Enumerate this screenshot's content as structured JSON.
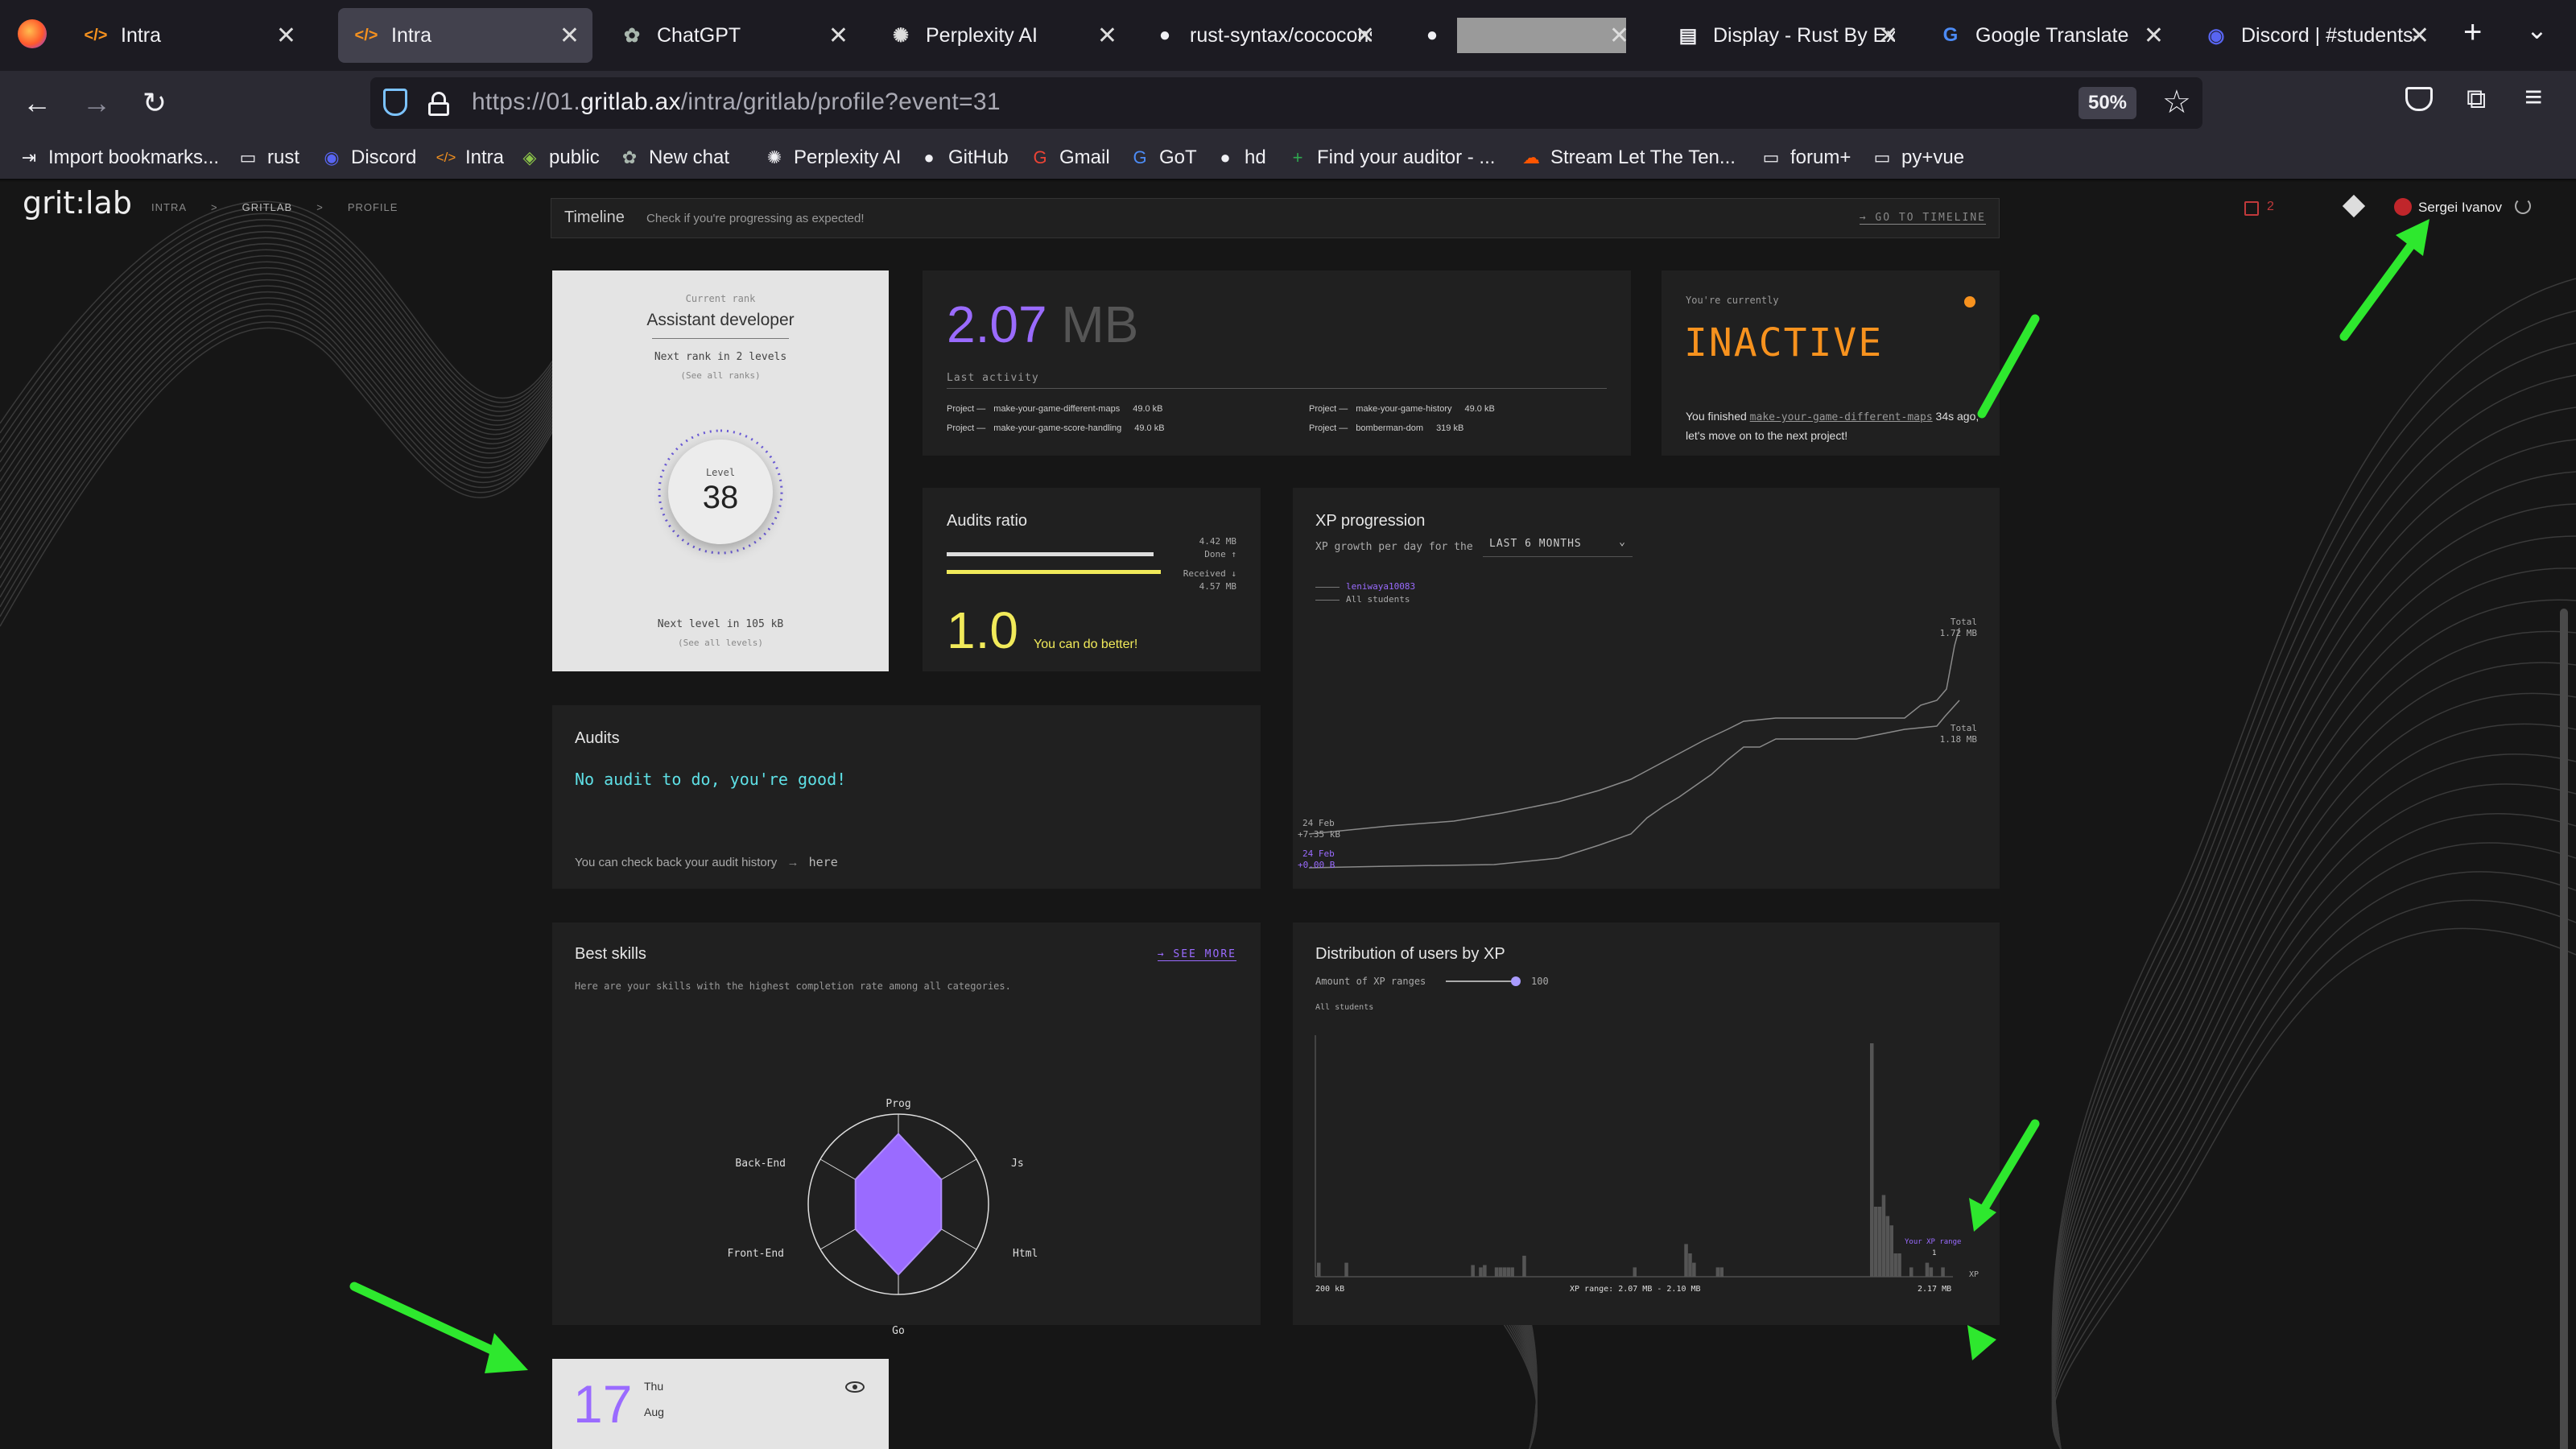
{
  "tabs": [
    {
      "label": "Intra",
      "icon": "code-icon",
      "active": false
    },
    {
      "label": "Intra",
      "icon": "code-icon",
      "active": true
    },
    {
      "label": "ChatGPT",
      "icon": "openai-icon",
      "active": false
    },
    {
      "label": "Perplexity AI",
      "icon": "perplexity-icon",
      "active": false
    },
    {
      "label": "rust-syntax/cococonscious",
      "icon": "github-icon",
      "active": false
    },
    {
      "label": "",
      "icon": "github-icon",
      "active": false
    },
    {
      "label": "Display - Rust By Example",
      "icon": "book-icon",
      "active": false
    },
    {
      "label": "Google Translate",
      "icon": "translate-icon",
      "active": false
    },
    {
      "label": "Discord | #students-",
      "icon": "discord-icon",
      "active": false
    }
  ],
  "url": {
    "prefix": "https://01.",
    "domain": "gritlab.ax",
    "path": "/intra/gritlab/profile?event=31"
  },
  "zoom": "50%",
  "bookmarks": [
    {
      "label": "Import bookmarks...",
      "icon": "import-icon"
    },
    {
      "label": "rust",
      "icon": "folder-icon"
    },
    {
      "label": "Discord",
      "icon": "discord-icon"
    },
    {
      "label": "Intra",
      "icon": "code-icon"
    },
    {
      "label": "public",
      "icon": "public-icon"
    },
    {
      "label": "New chat",
      "icon": "openai-icon"
    },
    {
      "label": "Perplexity AI",
      "icon": "perplexity-icon"
    },
    {
      "label": "GitHub",
      "icon": "github-icon"
    },
    {
      "label": "Gmail",
      "icon": "google-icon"
    },
    {
      "label": "GoT",
      "icon": "translate-icon"
    },
    {
      "label": "hd",
      "icon": "github-icon"
    },
    {
      "label": "Find your auditor - ...",
      "icon": "green-plus-icon"
    },
    {
      "label": "Stream Let The Ten...",
      "icon": "soundcloud-icon"
    },
    {
      "label": "forum+",
      "icon": "folder-icon"
    },
    {
      "label": "py+vue",
      "icon": "folder-icon"
    }
  ],
  "header": {
    "logo": "grit:lab",
    "crumbs": [
      "INTRA",
      ">",
      "GRITLAB",
      ">",
      "PROFILE"
    ],
    "notif_count": "2",
    "user": "Sergei Ivanov"
  },
  "timeline": {
    "title": "Timeline",
    "desc": "Check if you're progressing as expected!",
    "link": "→ GO TO TIMELINE"
  },
  "rank": {
    "caption": "Current rank",
    "name": "Assistant developer",
    "next": "Next rank in 2 levels",
    "see_ranks": "(See all ranks)",
    "level_label": "Level",
    "level": "38",
    "next_level": "Next level in 105 kB",
    "see_levels": "(See all levels)",
    "progress": 0.42
  },
  "xp": {
    "value": "2.07",
    "unit": "MB",
    "caption": "Last activity",
    "items": [
      {
        "kind": "Project —",
        "name": "make-your-game-different-maps",
        "size": "49.0 kB"
      },
      {
        "kind": "Project —",
        "name": "make-your-game-score-handling",
        "size": "49.0 kB"
      },
      {
        "kind": "Project —",
        "name": "make-your-game-history",
        "size": "49.0 kB"
      },
      {
        "kind": "Project —",
        "name": "bomberman-dom",
        "size": "319 kB"
      }
    ]
  },
  "status": {
    "caption": "You're currently",
    "state": "INACTIVE",
    "msg_a": "You finished",
    "project": "make-your-game-different-maps",
    "msg_b": "34s ago, let's move on to the next project!"
  },
  "audit_ratio": {
    "title": "Audits ratio",
    "done_val": "4.42 MB",
    "done_label": "Done ↑",
    "recv_label": "Received ↓",
    "recv_val": "4.57 MB",
    "ratio": "1.0",
    "comment": "You can do better!",
    "done_frac": 0.967,
    "recv_frac": 1.0
  },
  "audits": {
    "title": "Audits",
    "message": "No audit to do, you're good!",
    "history": "You can check back your audit history",
    "history_link": "here"
  },
  "xp_progression": {
    "title": "XP progression",
    "label": "XP growth per day for the",
    "period": "LAST 6 MONTHS",
    "legend": [
      "leniwaya10083",
      "All students"
    ],
    "total_user_label": "Total",
    "total_user": "1.72 MB",
    "total_all_label": "Total",
    "total_all": "1.18 MB",
    "start_user_date": "24 Feb",
    "start_user_val": "+7.35 kB",
    "start_all_date": "24 Feb",
    "start_all_val": "+0.00 B"
  },
  "skills": {
    "title": "Best skills",
    "see_more": "→ SEE MORE",
    "desc": "Here are your skills with the highest completion rate among all categories.",
    "axes": [
      "Prog",
      "Js",
      "Html",
      "Go",
      "Front-End",
      "Back-End"
    ]
  },
  "distribution": {
    "title": "Distribution of users by XP",
    "control_label": "Amount of XP ranges",
    "control_value": "100",
    "sublabel": "All students",
    "your_range_label": "Your XP range",
    "your_range_count": "1",
    "x_min": "200 kB",
    "x_mid": "XP range: 2.07 MB - 2.10 MB",
    "x_max": "2.17 MB",
    "x_unit": "XP"
  },
  "calendar": {
    "day": "17",
    "weekday": "Thu",
    "month": "Aug"
  },
  "chart_data": [
    {
      "type": "line",
      "title": "XP progression",
      "series": [
        {
          "name": "leniwaya10083",
          "start": "+7.35 kB",
          "total": "1.72 MB"
        },
        {
          "name": "All students",
          "start": "+0.00 B",
          "total": "1.18 MB"
        }
      ],
      "x_start": "24 Feb"
    },
    {
      "type": "bar",
      "title": "Distribution of users by XP",
      "x_range": [
        "200 kB",
        "2.17 MB"
      ],
      "values": [
        6,
        0,
        0,
        0,
        0,
        0,
        0,
        6,
        0,
        0,
        0,
        0,
        0,
        0,
        0,
        0,
        0,
        0,
        0,
        0,
        0,
        0,
        0,
        0,
        0,
        0,
        0,
        0,
        0,
        0,
        0,
        0,
        0,
        0,
        0,
        0,
        0,
        0,
        0,
        5,
        0,
        4,
        5,
        0,
        0,
        4,
        4,
        4,
        4,
        4,
        0,
        0,
        9,
        0,
        0,
        0,
        0,
        0,
        0,
        0,
        0,
        0,
        0,
        0,
        0,
        0,
        0,
        0,
        0,
        0,
        0,
        0,
        0,
        0,
        0,
        0,
        0,
        0,
        0,
        0,
        4,
        0,
        0,
        0,
        0,
        0,
        0,
        0,
        0,
        0,
        0,
        0,
        0,
        14,
        10,
        6,
        0,
        0,
        0,
        0,
        0,
        4,
        4,
        0,
        0,
        0,
        0,
        0,
        0,
        0,
        0,
        0,
        0,
        0,
        0,
        0,
        0,
        0,
        0,
        0,
        0,
        0,
        0,
        0,
        0,
        0,
        0,
        0,
        0,
        0,
        0,
        0,
        0,
        0,
        0,
        0,
        0,
        0,
        0,
        0,
        100,
        30,
        30,
        35,
        26,
        22,
        10,
        10,
        0,
        0,
        4,
        0,
        0,
        0,
        6,
        4,
        0,
        0,
        4,
        0,
        0
      ]
    }
  ]
}
